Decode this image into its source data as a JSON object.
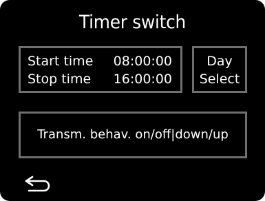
{
  "header": {
    "title": "Timer switch"
  },
  "times": {
    "start_label": "Start time",
    "start_value": "08:00:00",
    "stop_label": "Stop time",
    "stop_value": "16:00:00"
  },
  "day_select": {
    "line1": "Day",
    "line2": "Select"
  },
  "transmission": {
    "label": "Transm. behav. on/off|down/up"
  },
  "footer": {
    "back_icon": "back-arrow-icon"
  },
  "colors": {
    "background": "#000000",
    "text": "#ffffff",
    "border": "#6f6f6f"
  }
}
